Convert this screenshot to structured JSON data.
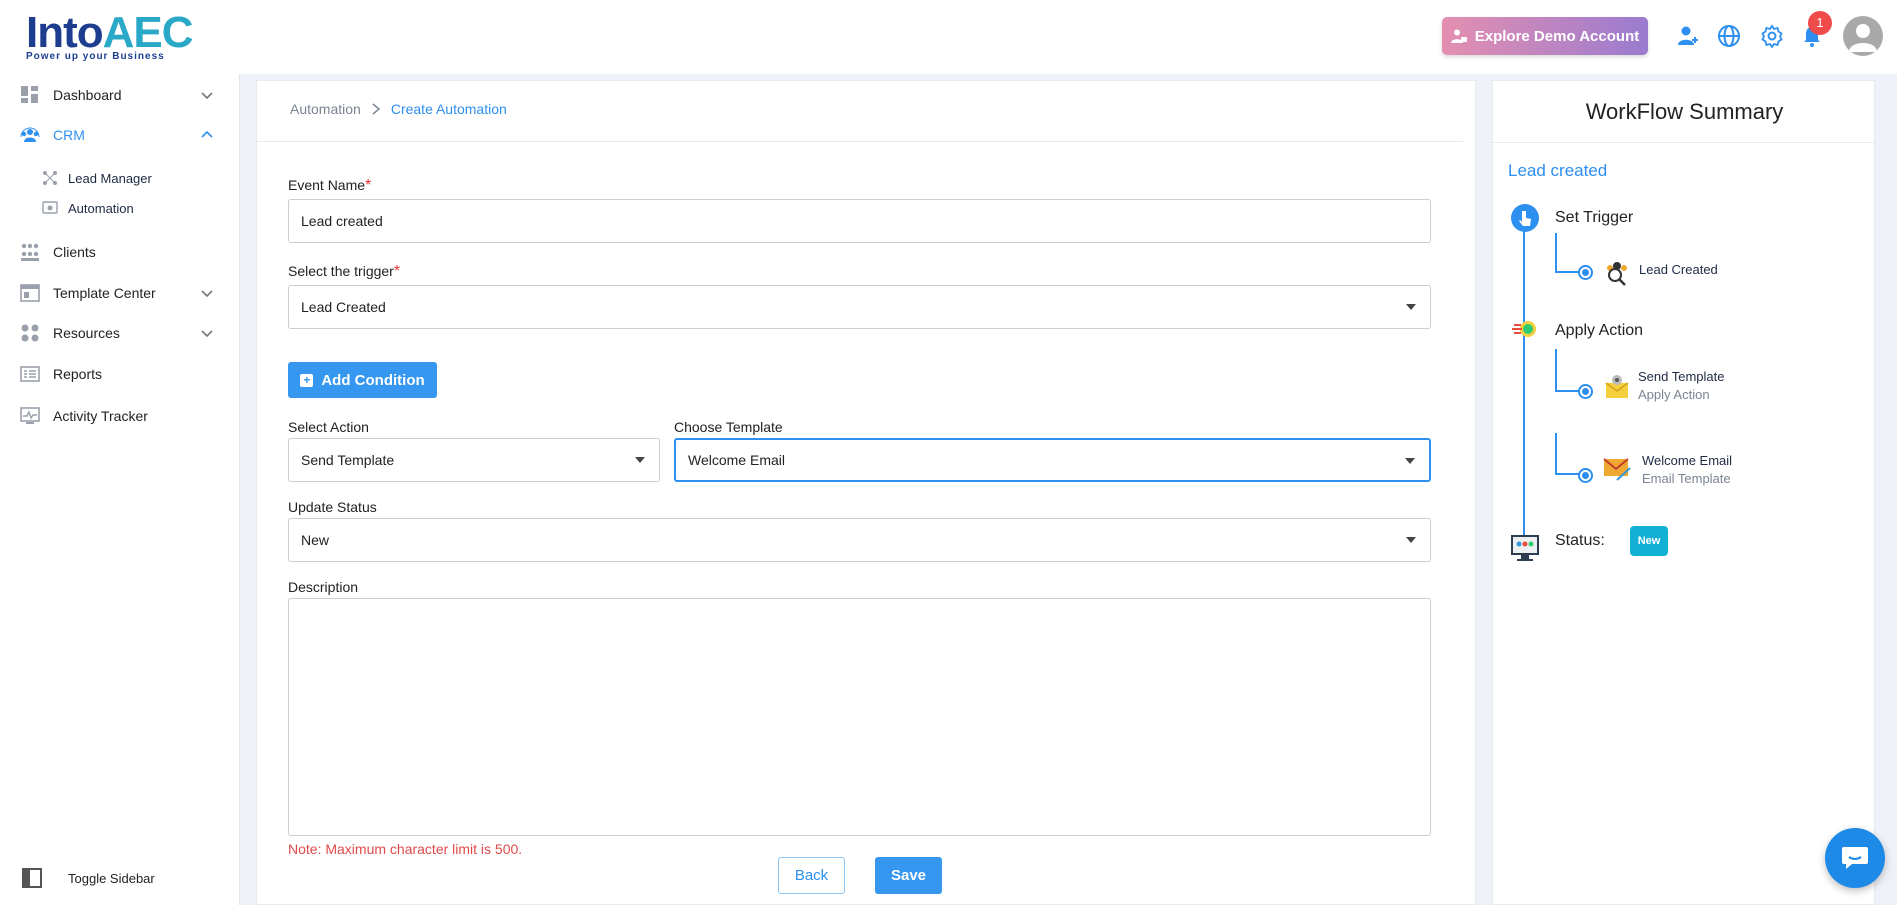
{
  "brand": {
    "logo_main": "Into",
    "logo_accent": "AEC",
    "tagline": "Power up your Business"
  },
  "header": {
    "demo_button": "Explore Demo Account",
    "notification_count": "1"
  },
  "sidebar": {
    "items": [
      {
        "label": "Dashboard"
      },
      {
        "label": "CRM"
      },
      {
        "label": "Clients"
      },
      {
        "label": "Template Center"
      },
      {
        "label": "Resources"
      },
      {
        "label": "Reports"
      },
      {
        "label": "Activity Tracker"
      }
    ],
    "crm_sub": [
      {
        "label": "Lead Manager"
      },
      {
        "label": "Automation"
      }
    ],
    "toggle_label": "Toggle Sidebar"
  },
  "breadcrumb": {
    "parent": "Automation",
    "current": "Create Automation"
  },
  "form": {
    "event_name_label": "Event Name",
    "event_name_value": "Lead created",
    "trigger_label": "Select the trigger",
    "trigger_value": "Lead Created",
    "add_condition": "Add Condition",
    "action_label": "Select Action",
    "action_value": "Send Template",
    "template_label": "Choose Template",
    "template_value": "Welcome Email",
    "status_label": "Update Status",
    "status_value": "New",
    "description_label": "Description",
    "description_value": "",
    "note": "Note: Maximum character limit is 500.",
    "back": "Back",
    "save": "Save",
    "required_mark": "*"
  },
  "summary": {
    "title": "WorkFlow Summary",
    "event": "Lead created",
    "trigger_title": "Set Trigger",
    "trigger_leaf": "Lead Created",
    "action_title": "Apply Action",
    "action_leaf_main": "Send Template",
    "action_leaf_sub": "Apply Action",
    "template_leaf_main": "Welcome Email",
    "template_leaf_sub": "Email Template",
    "status_title": "Status:",
    "status_badge": "New"
  },
  "colors": {
    "accent": "#2d8ff0",
    "button": "#3597ef",
    "required": "#e33333",
    "badge": "#13b0d6"
  }
}
